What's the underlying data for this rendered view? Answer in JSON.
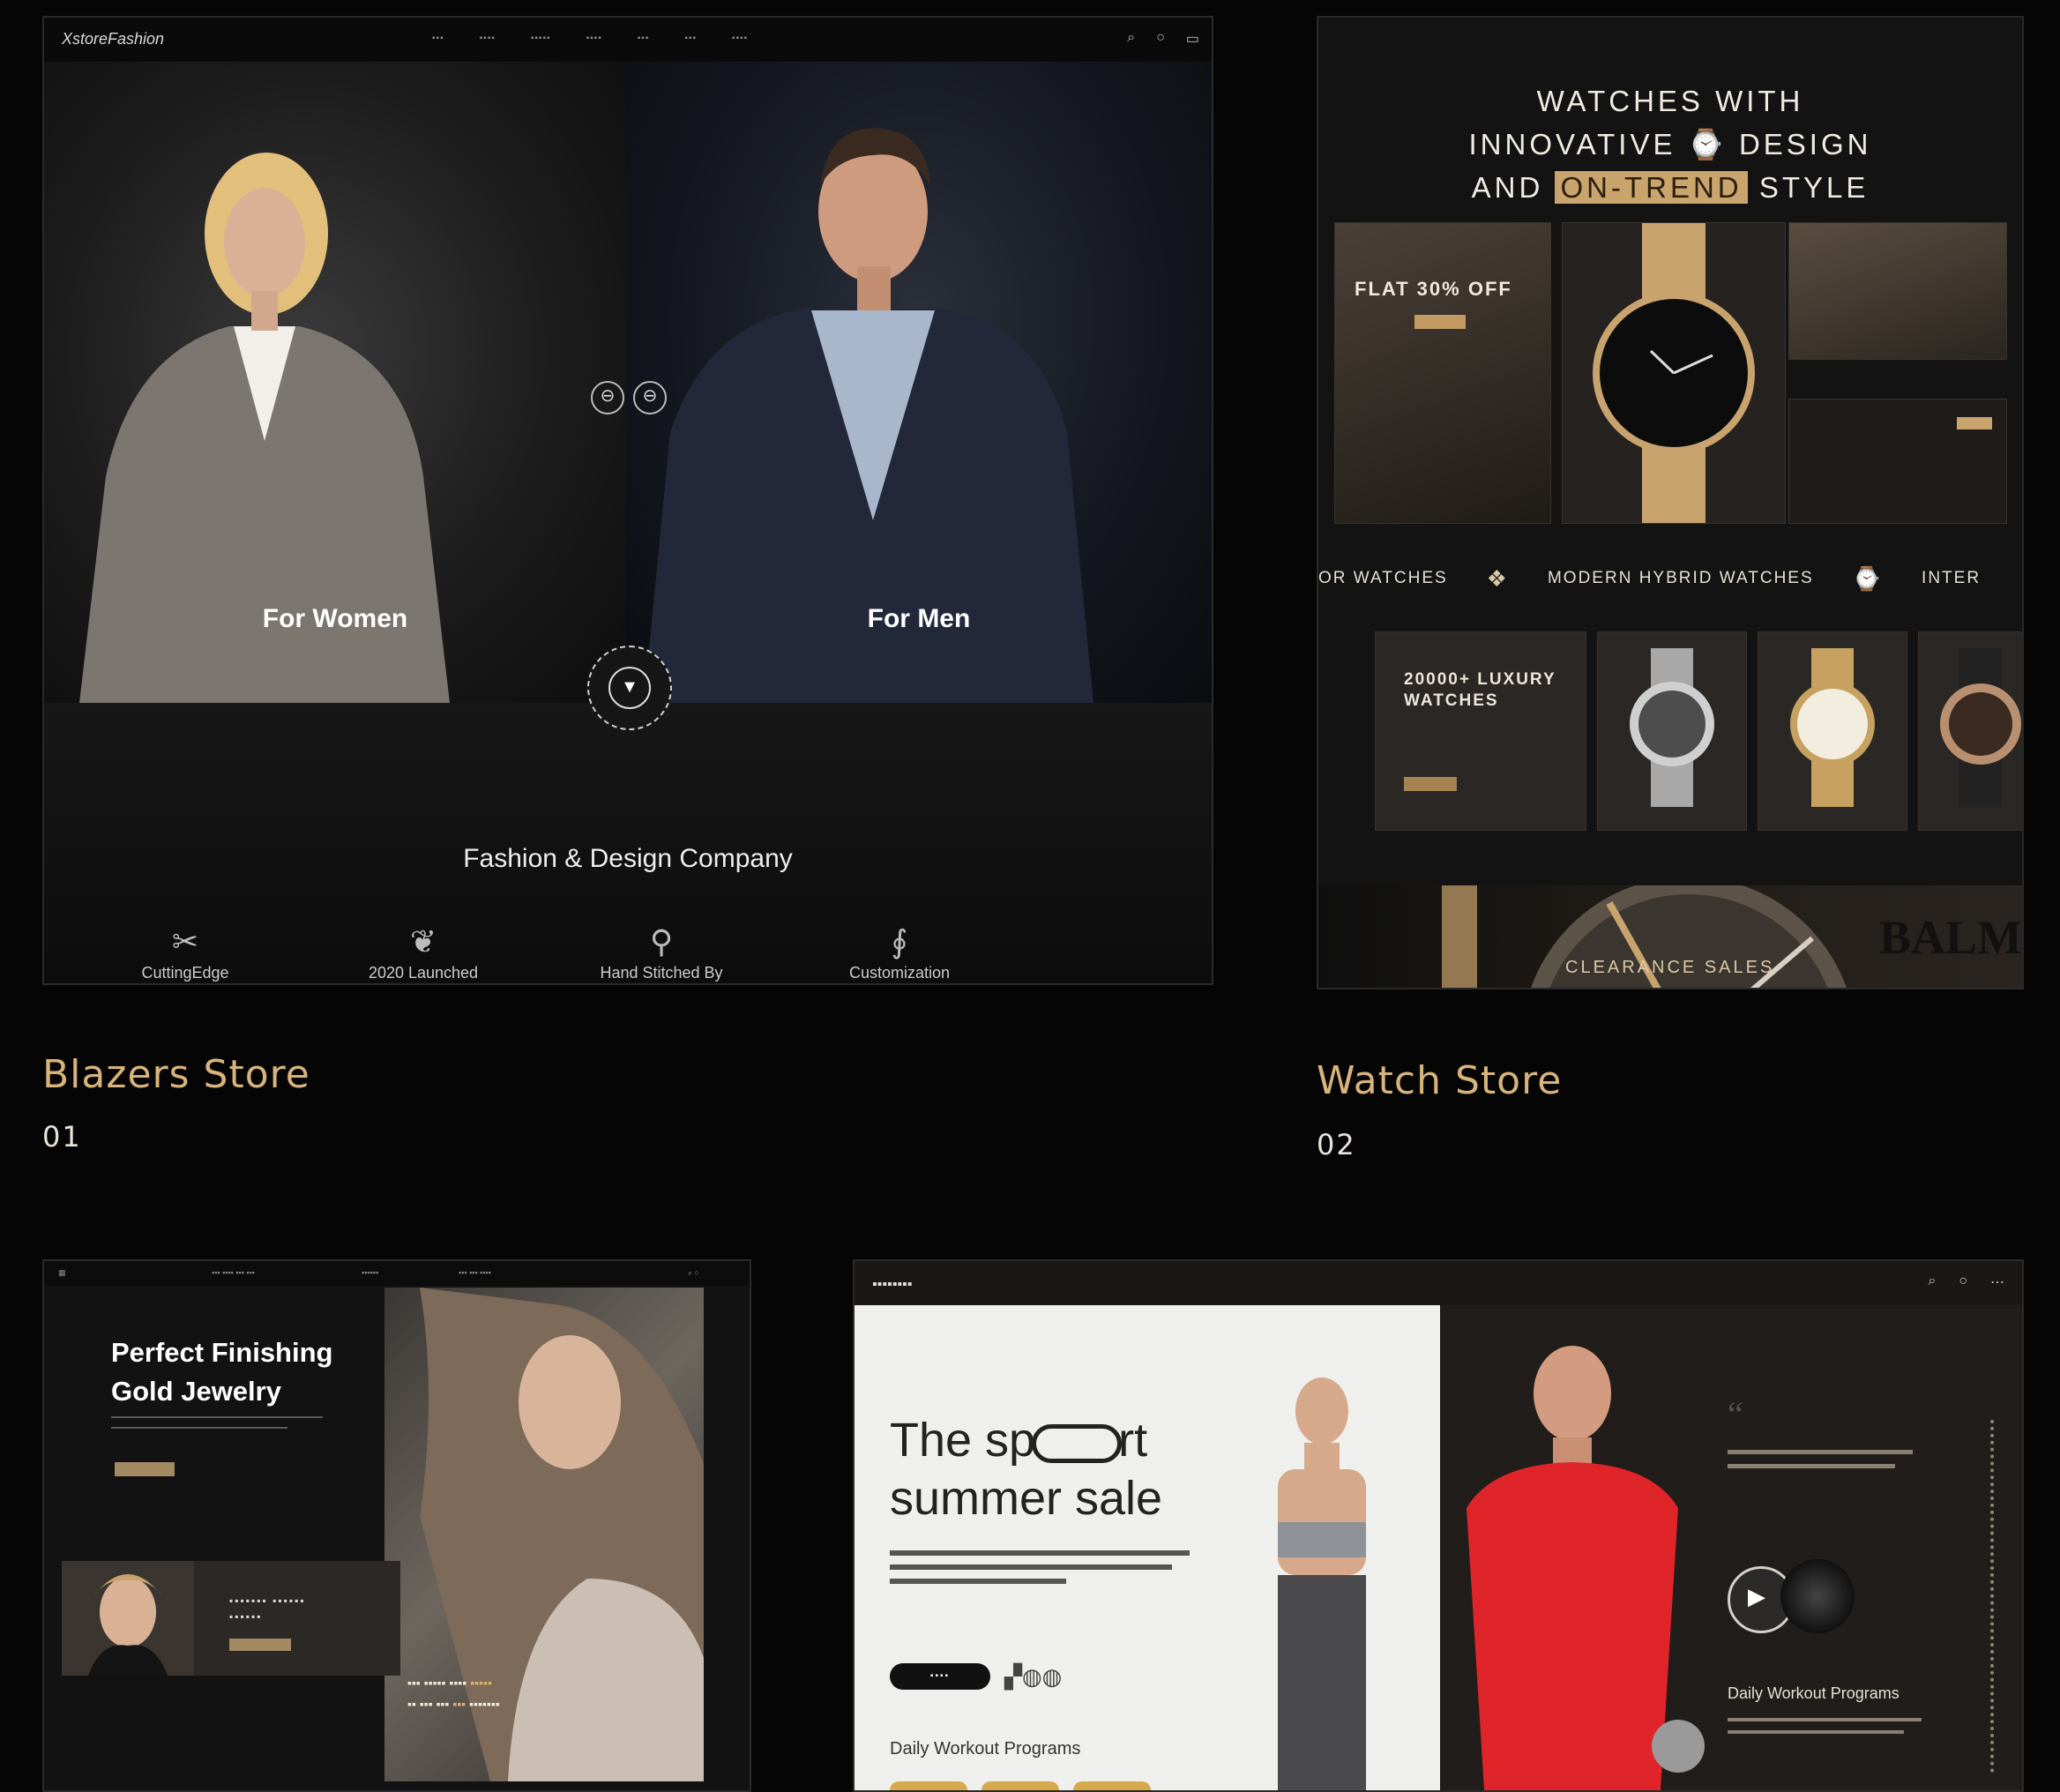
{
  "projects": [
    {
      "title": "Blazers Store",
      "number": "01",
      "nav": {
        "logo": "XstoreFashion",
        "icons": [
          "search-icon",
          "user-icon",
          "cart-icon"
        ]
      },
      "panels": {
        "women": "For Women",
        "men": "For Men"
      },
      "company": "Fashion & Design Company",
      "features": [
        "CuttingEdge",
        "2020 Launched",
        "Hand Stitched By",
        "Customization"
      ]
    },
    {
      "title": "Watch Store",
      "number": "02",
      "hero": {
        "line1": "WATCHES WITH",
        "line2a": "INNOVATIVE",
        "line2b": "DESIGN",
        "line3a": "AND",
        "line3hl": "ON-TREND",
        "line3b": "STYLE"
      },
      "promo": "FLAT 30% OFF",
      "strip": [
        "OR WATCHES",
        "MODERN HYBRID WATCHES",
        "INTER"
      ],
      "luxury": "20000+ LUXURY WATCHES",
      "brand": "BALM",
      "clearance": "CLEARANCE SALES"
    },
    {
      "heading_line1": "Perfect Finishing",
      "heading_line2": "Gold Jewelry"
    },
    {
      "title_line1a": "The sp",
      "title_line1b": "rt",
      "title_line2": "summer sale",
      "daily_left": "Daily Workout Programs",
      "daily_right": "Daily Workout Programs"
    }
  ],
  "colors": {
    "accent": "#d8b47c",
    "background": "#050505"
  }
}
